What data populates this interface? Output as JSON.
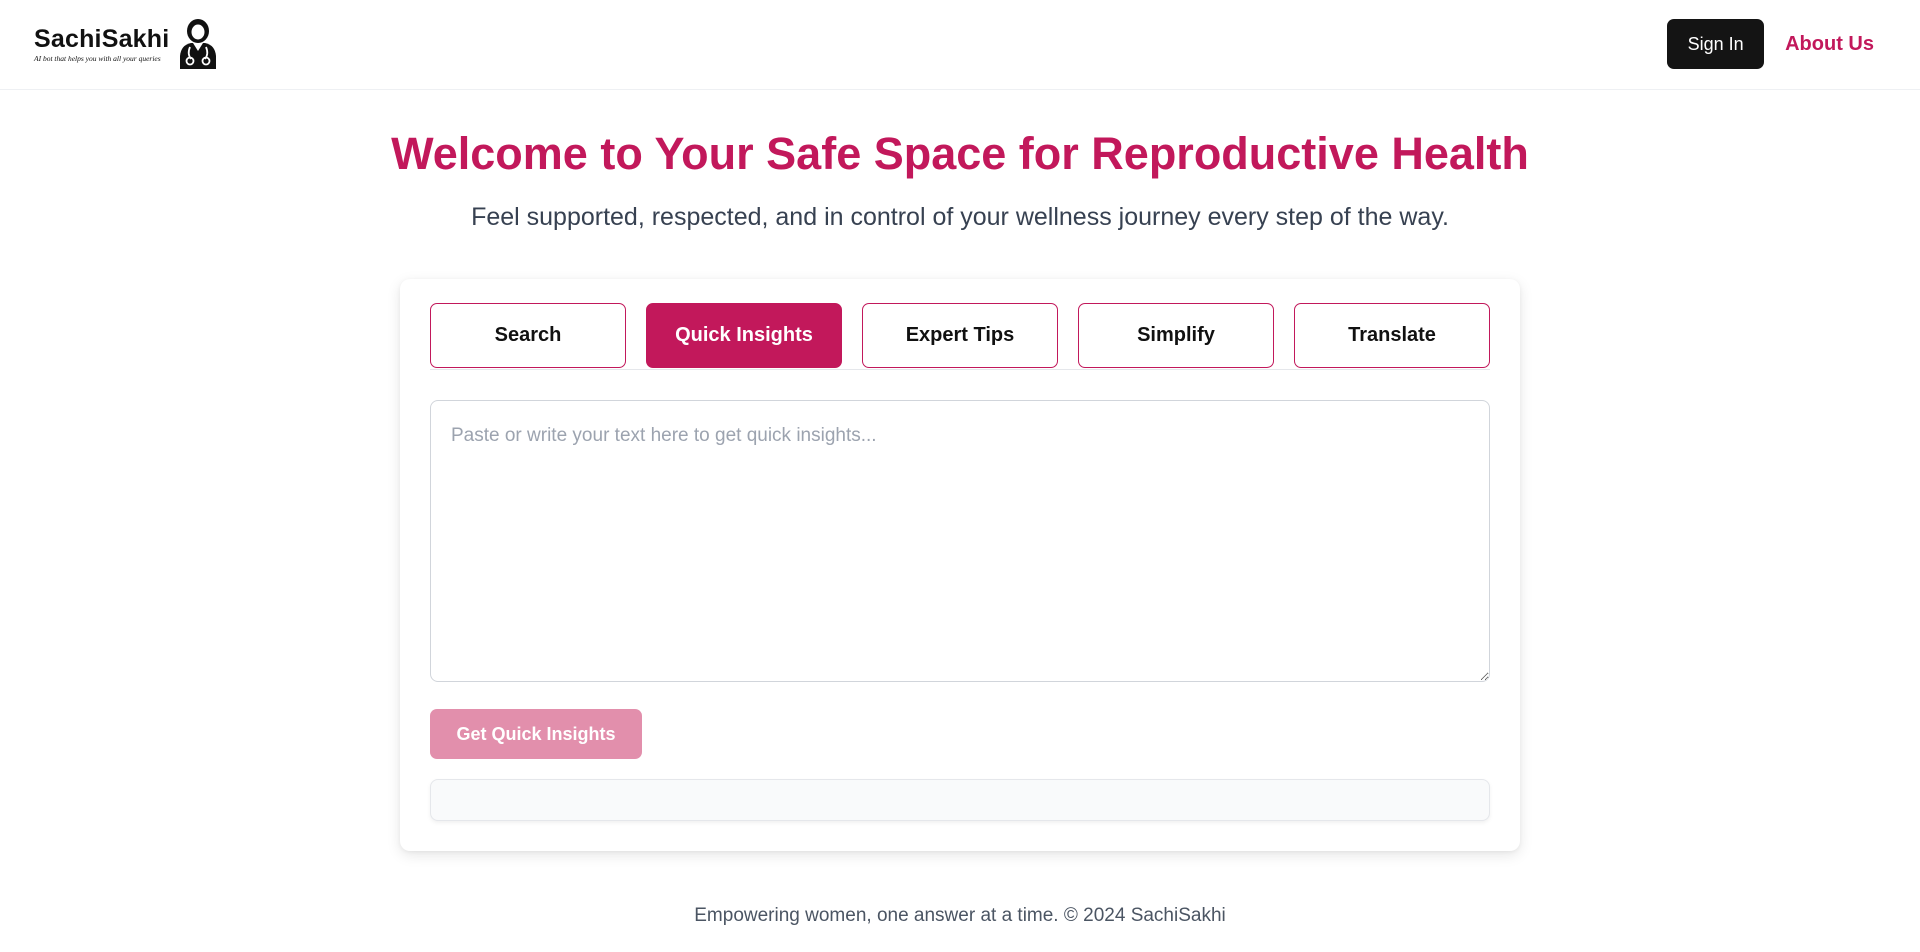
{
  "header": {
    "brand_name": "SachiSakhi",
    "brand_tagline": "AI bot that helps you with all your queries",
    "logo_icon": "woman-doctor-icon",
    "signin_label": "Sign In",
    "about_label": "About Us"
  },
  "hero": {
    "title": "Welcome to Your Safe Space for Reproductive Health",
    "subtitle": "Feel supported, respected, and in control of your wellness journey every step of the way."
  },
  "tabs": [
    {
      "label": "Search",
      "active": false
    },
    {
      "label": "Quick Insights",
      "active": true
    },
    {
      "label": "Expert Tips",
      "active": false
    },
    {
      "label": "Simplify",
      "active": false
    },
    {
      "label": "Translate",
      "active": false
    }
  ],
  "input": {
    "value": "",
    "placeholder": "Paste or write your text here to get quick insights..."
  },
  "action": {
    "submit_label": "Get Quick Insights"
  },
  "result": {
    "text": ""
  },
  "footer": {
    "text": "Empowering women, one answer at a time. © 2024 SachiSakhi"
  },
  "colors": {
    "accent": "#c2185b",
    "accent_disabled": "#e28fac",
    "signin_bg": "#141414"
  }
}
